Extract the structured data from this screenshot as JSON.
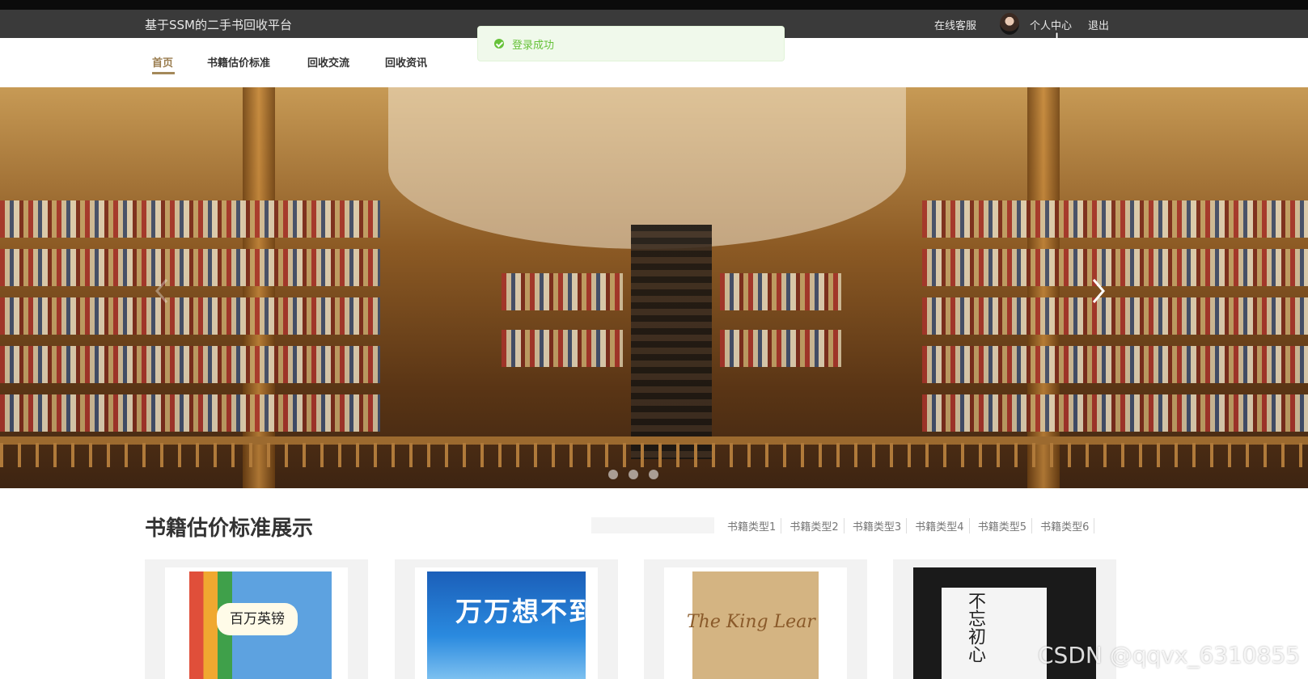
{
  "header": {
    "site_title": "基于SSM的二手书回收平台",
    "service_link": "在线客服",
    "user_center_link": "个人中心",
    "logout_link": "退出"
  },
  "nav": {
    "items": [
      {
        "label": "首页",
        "active": true
      },
      {
        "label": "书籍估价标准",
        "active": false
      },
      {
        "label": "回收交流",
        "active": false
      },
      {
        "label": "回收资讯",
        "active": false
      }
    ]
  },
  "toast": {
    "message": "登录成功",
    "type": "success"
  },
  "banner": {
    "slide_count": 3,
    "active_slide": 1
  },
  "section": {
    "title": "书籍估价标准展示",
    "categories": [
      "书籍类型1",
      "书籍类型2",
      "书籍类型3",
      "书籍类型4",
      "书籍类型5",
      "书籍类型6"
    ]
  },
  "books": [
    {
      "cover_title": "百万英镑"
    },
    {
      "cover_title": "万万想不到"
    },
    {
      "cover_title": "The King Lear"
    },
    {
      "cover_title": "不忘初心"
    }
  ],
  "watermark": "CSDN @qqvx_6310855",
  "colors": {
    "topbar_bg": "#3a3a3a",
    "nav_active": "#9a7d4f",
    "toast_success": "#67c23a",
    "toast_bg": "#f0f9eb"
  }
}
